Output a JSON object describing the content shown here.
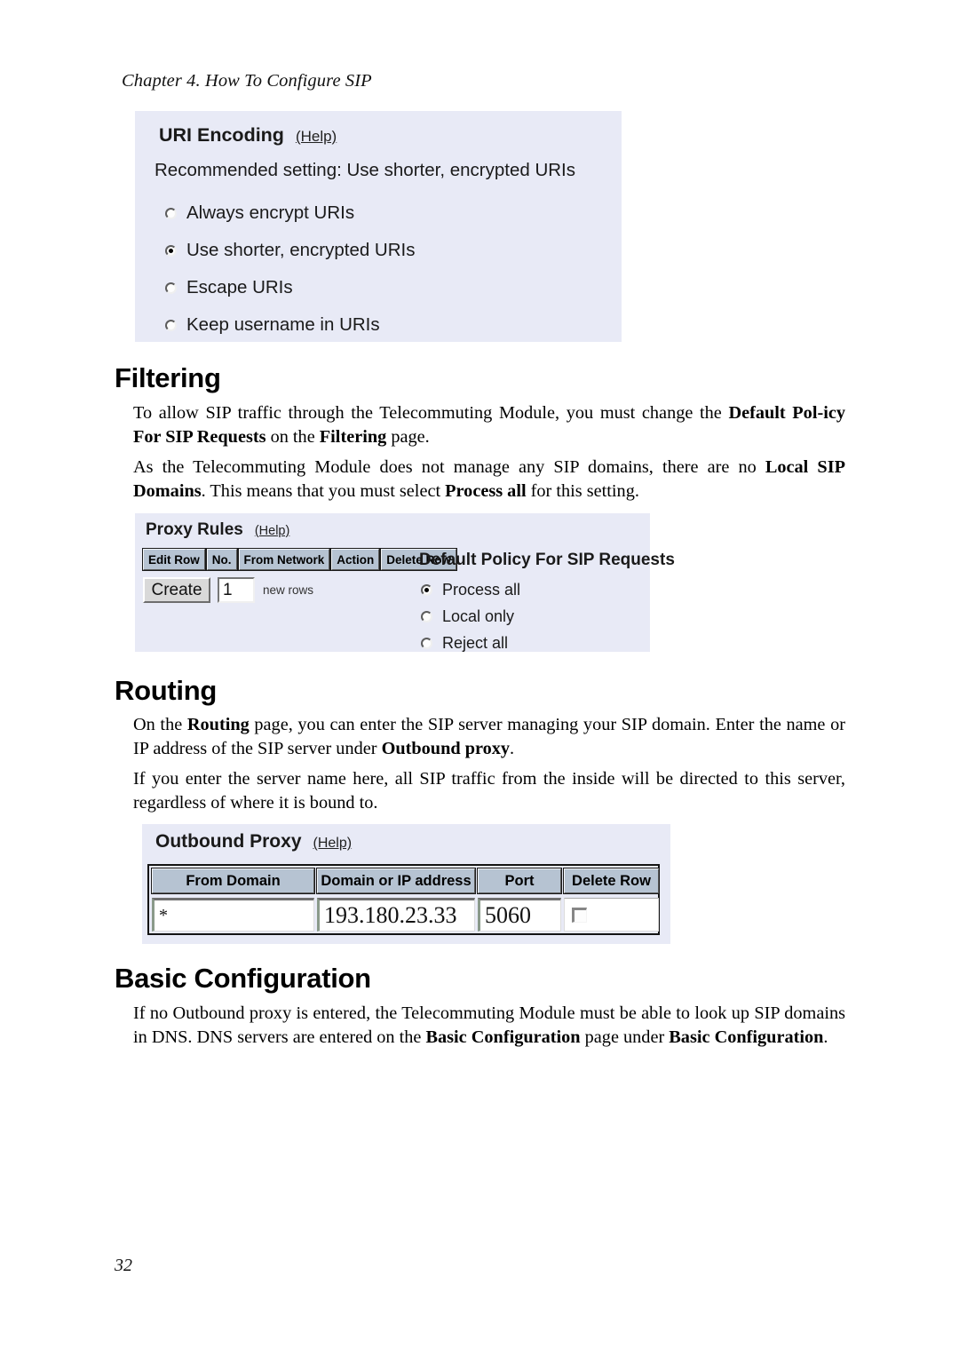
{
  "document": {
    "running_head": "Chapter 4. How To Configure SIP",
    "page_number": "32"
  },
  "uri_encoding_panel": {
    "title": "URI Encoding",
    "help_label": "(Help)",
    "recommended_text": "Recommended setting: Use shorter, encrypted URIs",
    "options": [
      {
        "label": "Always encrypt URIs",
        "selected": false
      },
      {
        "label": "Use shorter, encrypted URIs",
        "selected": true
      },
      {
        "label": "Escape URIs",
        "selected": false
      },
      {
        "label": "Keep username in URIs",
        "selected": false
      }
    ]
  },
  "filtering_section": {
    "heading": "Filtering",
    "paragraph1_part1": "To allow SIP traffic through the Telecommuting Module, you must change the ",
    "paragraph1_bold1": "Default Pol-",
    "paragraph1_bold2": "icy For SIP Requests",
    "paragraph1_part2": " on the ",
    "paragraph1_bold3": "Filtering",
    "paragraph1_part3": " page.",
    "paragraph2_part1": "As the Telecommuting Module does not manage any SIP domains, there are no ",
    "paragraph2_bold1": "Local SIP",
    "paragraph2_bold2": "Domains",
    "paragraph2_part2": ". This means that you must select ",
    "paragraph2_bold3": "Process all",
    "paragraph2_part3": " for this setting."
  },
  "proxy_rules_panel": {
    "title": "Proxy Rules",
    "help_label": "(Help)",
    "table_headers": [
      "Edit Row",
      "No.",
      "From Network",
      "Action",
      "Delete Row"
    ],
    "create_button_label": "Create",
    "create_rows_value": "1",
    "create_rows_suffix": "new rows",
    "policy_title": "Default Policy For SIP Requests",
    "policy_options": [
      {
        "label": "Process all",
        "selected": true
      },
      {
        "label": "Local only",
        "selected": false
      },
      {
        "label": "Reject all",
        "selected": false
      }
    ]
  },
  "routing_section": {
    "heading": "Routing",
    "paragraph1_part1": "On the ",
    "paragraph1_bold1": "Routing",
    "paragraph1_part2": " page, you can enter the SIP server managing your SIP domain. Enter the name or IP address of the SIP server under ",
    "paragraph1_bold2": "Outbound proxy",
    "paragraph1_part3": ".",
    "paragraph2": "If you enter the server name here, all SIP traffic from the inside will be directed to this server, regardless of where it is bound to."
  },
  "outbound_proxy_panel": {
    "title": "Outbound Proxy",
    "help_label": "(Help)",
    "columns": [
      "From Domain",
      "Domain or IP address",
      "Port",
      "Delete Row"
    ],
    "row": {
      "from_domain": "*",
      "domain_or_ip": "193.180.23.33",
      "port": "5060",
      "delete_row_checked": false
    }
  },
  "basic_configuration_section": {
    "heading": "Basic Configuration",
    "paragraph_part1": "If no Outbound proxy is entered, the Telecommuting Module must be able to look up SIP domains in DNS. DNS servers are entered on the ",
    "paragraph_bold1": "Basic Configuration",
    "paragraph_part2": " page under ",
    "paragraph_bold2": "Basic",
    "paragraph_bold3": "Configuration",
    "paragraph_part3": "."
  },
  "colors": {
    "panel_background": "#e8eaf6",
    "header_cell": "#b6c3d2",
    "button_face": "#d9d9d9"
  }
}
